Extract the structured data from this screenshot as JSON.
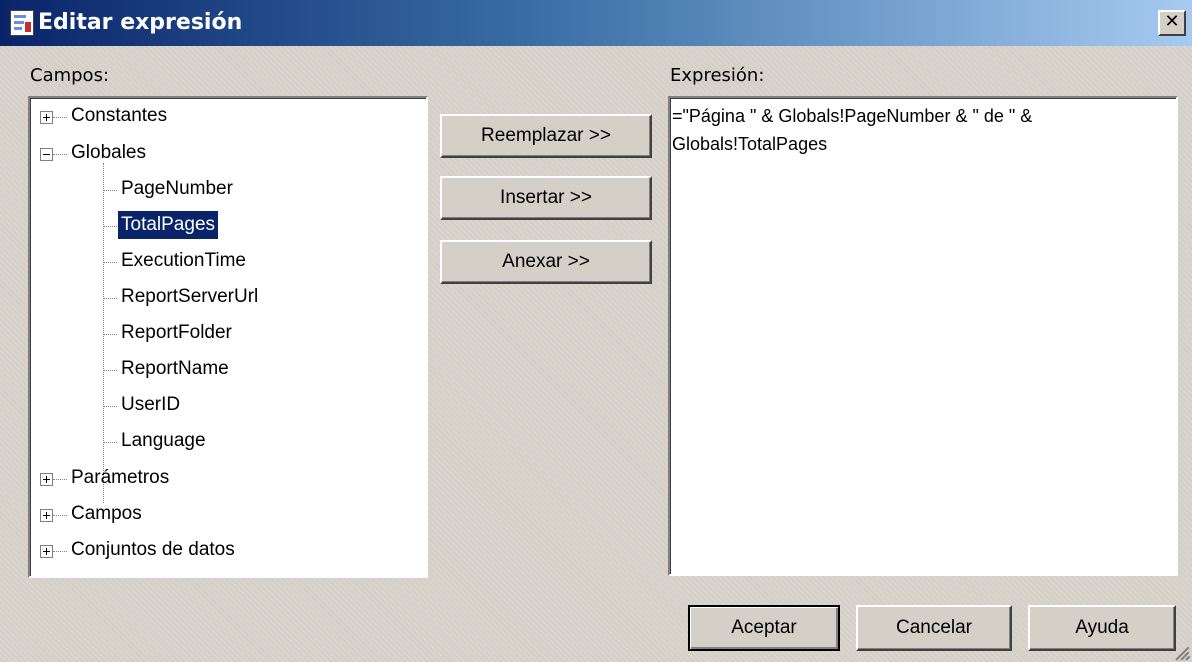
{
  "window": {
    "title": "Editar expresión",
    "close_glyph": "✕"
  },
  "fields_label": "Campos:",
  "expression_label": "Expresión:",
  "expression_value": "=\"Página \" & Globals!PageNumber & \" de \" & Globals!TotalPages",
  "tree": {
    "constantes": "Constantes",
    "globales": "Globales",
    "globales_children": [
      "PageNumber",
      "TotalPages",
      "ExecutionTime",
      "ReportServerUrl",
      "ReportFolder",
      "ReportName",
      "UserID",
      "Language"
    ],
    "selected": "TotalPages",
    "parametros": "Parámetros",
    "campos": "Campos",
    "conjuntos": "Conjuntos de datos"
  },
  "buttons": {
    "reemplazar": "Reemplazar >>",
    "insertar": "Insertar >>",
    "anexar": "Anexar >>",
    "aceptar": "Aceptar",
    "cancelar": "Cancelar",
    "ayuda": "Ayuda"
  },
  "colors": {
    "selection": "#0a246a",
    "titlebar_start": "#0a246a",
    "titlebar_end": "#a6caf0",
    "face": "#d4d0c8"
  },
  "icons": {
    "title": "report-icon",
    "expand": "plus-icon",
    "collapse": "minus-icon"
  }
}
